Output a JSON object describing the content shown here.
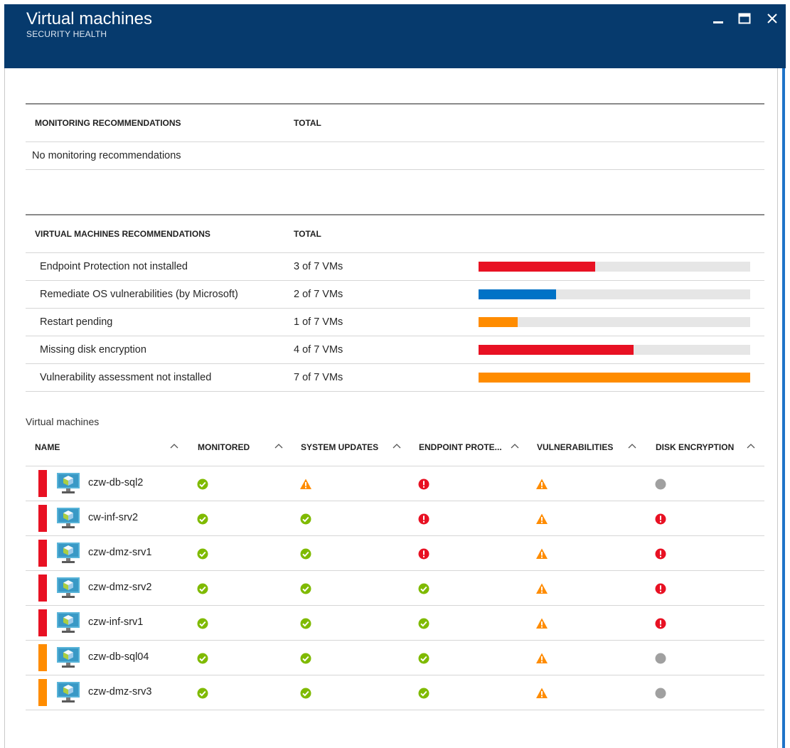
{
  "window": {
    "title": "Virtual machines",
    "subtitle": "SECURITY HEALTH",
    "controls": [
      "minimize-icon",
      "maximize-icon",
      "close-icon"
    ]
  },
  "colors": {
    "header_bg": "#063a6d",
    "red": "#e81123",
    "blue": "#0072c6",
    "orange": "#ff8c00",
    "green": "#7fba00",
    "gray": "#a0a0a0"
  },
  "monitoring": {
    "header_name": "MONITORING RECOMMENDATIONS",
    "header_total": "TOTAL",
    "empty_text": "No monitoring recommendations"
  },
  "vm_recommendations": {
    "header_name": "VIRTUAL MACHINES RECOMMENDATIONS",
    "header_total": "TOTAL",
    "rows": [
      {
        "name": "Endpoint Protection not installed",
        "total": "3 of 7 VMs",
        "fraction": 0.4286,
        "color": "#e81123"
      },
      {
        "name": "Remediate OS vulnerabilities (by Microsoft)",
        "total": "2 of 7 VMs",
        "fraction": 0.2857,
        "color": "#0072c6"
      },
      {
        "name": "Restart pending",
        "total": "1 of 7 VMs",
        "fraction": 0.1429,
        "color": "#ff8c00"
      },
      {
        "name": "Missing disk encryption",
        "total": "4 of 7 VMs",
        "fraction": 0.5714,
        "color": "#e81123"
      },
      {
        "name": "Vulnerability assessment not installed",
        "total": "7 of 7 VMs",
        "fraction": 1.0,
        "color": "#ff8c00"
      }
    ]
  },
  "vm_list": {
    "caption": "Virtual machines",
    "columns": [
      "NAME",
      "MONITORED",
      "SYSTEM UPDATES",
      "ENDPOINT PROTE...",
      "VULNERABILITIES",
      "DISK ENCRYPTION"
    ],
    "rows": [
      {
        "name": "czw-db-sql2",
        "severity": "#e81123",
        "status": [
          "ok",
          "warning",
          "error",
          "warning",
          "none"
        ]
      },
      {
        "name": "cw-inf-srv2",
        "severity": "#e81123",
        "status": [
          "ok",
          "ok",
          "error",
          "warning",
          "error"
        ]
      },
      {
        "name": "czw-dmz-srv1",
        "severity": "#e81123",
        "status": [
          "ok",
          "ok",
          "error",
          "warning",
          "error"
        ]
      },
      {
        "name": "czw-dmz-srv2",
        "severity": "#e81123",
        "status": [
          "ok",
          "ok",
          "ok",
          "warning",
          "error"
        ]
      },
      {
        "name": "czw-inf-srv1",
        "severity": "#e81123",
        "status": [
          "ok",
          "ok",
          "ok",
          "warning",
          "error"
        ]
      },
      {
        "name": "czw-db-sql04",
        "severity": "#ff8c00",
        "status": [
          "ok",
          "ok",
          "ok",
          "warning",
          "none"
        ]
      },
      {
        "name": "czw-dmz-srv3",
        "severity": "#ff8c00",
        "status": [
          "ok",
          "ok",
          "ok",
          "warning",
          "none"
        ]
      }
    ]
  }
}
